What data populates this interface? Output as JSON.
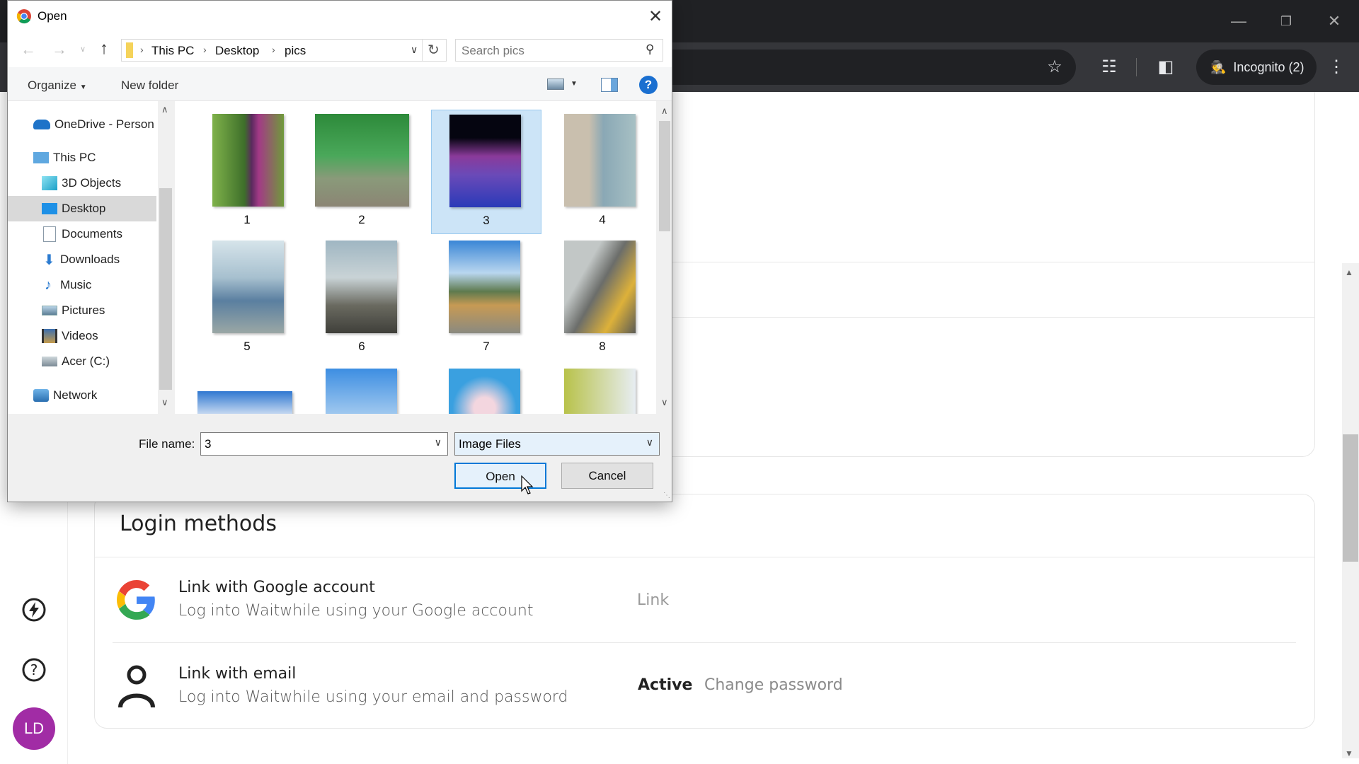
{
  "browser": {
    "incognito_label": "Incognito (2)",
    "window_controls": [
      "minimize-icon",
      "restore-icon",
      "close-icon"
    ],
    "toolbar_icons": [
      "star-icon",
      "extensions-icon",
      "side-panel-icon",
      "incognito-icon",
      "kebab-menu-icon"
    ]
  },
  "dialog": {
    "title": "Open",
    "breadcrumb": [
      "This PC",
      "Desktop",
      "pics"
    ],
    "search_placeholder": "Search pics",
    "organize_label": "Organize",
    "new_folder_label": "New folder",
    "nav_items": [
      {
        "label": "OneDrive - Person",
        "icon": "onedrive-icon",
        "selected": false
      },
      {
        "label": "This PC",
        "icon": "pc-icon",
        "selected": false
      },
      {
        "label": "3D Objects",
        "icon": "3d-objects-icon",
        "selected": false
      },
      {
        "label": "Desktop",
        "icon": "desktop-icon",
        "selected": true
      },
      {
        "label": "Documents",
        "icon": "documents-icon",
        "selected": false
      },
      {
        "label": "Downloads",
        "icon": "downloads-icon",
        "selected": false
      },
      {
        "label": "Music",
        "icon": "music-icon",
        "selected": false
      },
      {
        "label": "Pictures",
        "icon": "pictures-icon",
        "selected": false
      },
      {
        "label": "Videos",
        "icon": "videos-icon",
        "selected": false
      },
      {
        "label": "Acer (C:)",
        "icon": "drive-icon",
        "selected": false
      },
      {
        "label": "Network",
        "icon": "network-icon",
        "selected": false
      }
    ],
    "files": [
      {
        "name": "1",
        "selected": false
      },
      {
        "name": "2",
        "selected": false
      },
      {
        "name": "3",
        "selected": true
      },
      {
        "name": "4",
        "selected": false
      },
      {
        "name": "5",
        "selected": false
      },
      {
        "name": "6",
        "selected": false
      },
      {
        "name": "7",
        "selected": false
      },
      {
        "name": "8",
        "selected": false
      },
      {
        "name": "",
        "selected": false
      },
      {
        "name": "",
        "selected": false
      },
      {
        "name": "",
        "selected": false
      },
      {
        "name": "",
        "selected": false
      }
    ],
    "file_name_label": "File name:",
    "file_name_value": "3",
    "file_type_value": "Image Files",
    "open_label": "Open",
    "cancel_label": "Cancel"
  },
  "page": {
    "login_methods_title": "Login methods",
    "methods": [
      {
        "title": "Link with Google account",
        "subtitle": "Log into Waitwhile using your Google account",
        "action": "Link"
      },
      {
        "title": "Link with email",
        "subtitle": "Log into Waitwhile using your email and password",
        "status": "Active",
        "action": "Change password"
      }
    ],
    "avatar_initials": "LD",
    "avatar_color": "#a12ca5"
  }
}
